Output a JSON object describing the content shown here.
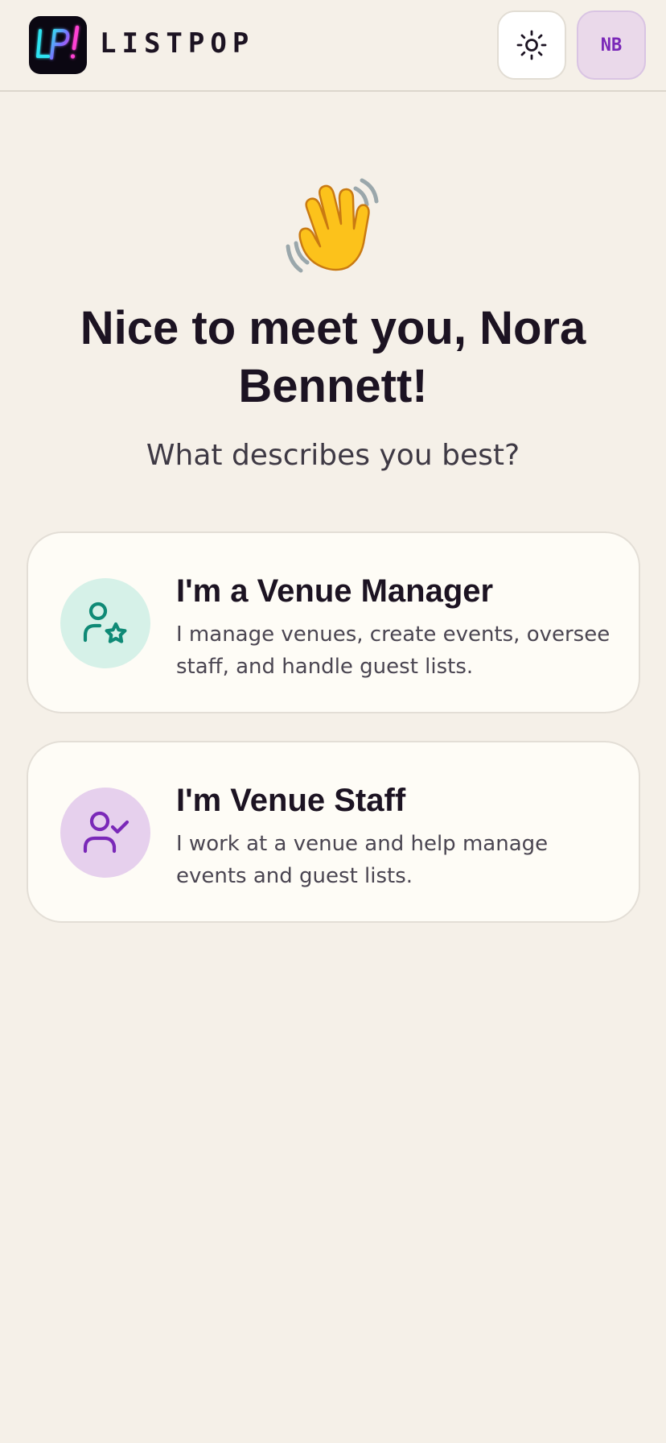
{
  "header": {
    "brand": "LISTPOP",
    "logo_text": "LP!",
    "theme_icon": "sun-icon",
    "avatar_initials": "NB"
  },
  "hero": {
    "emoji": "waving-hand-emoji",
    "title": "Nice to meet you, Nora Bennett!",
    "subtitle": "What describes you best?"
  },
  "roles": [
    {
      "title": "I'm a Venue Manager",
      "description": "I manage venues, create events, oversee staff, and handle guest lists.",
      "icon": "user-star-icon",
      "accent": "#0f8a76",
      "icon_bg": "#d6f1e8"
    },
    {
      "title": "I'm Venue Staff",
      "description": "I work at a venue and help manage events and guest lists.",
      "icon": "user-check-icon",
      "accent": "#7a28b8",
      "icon_bg": "#e6d0ed"
    }
  ],
  "colors": {
    "background": "#f5f0e8",
    "card": "#fefcf6",
    "text": "#1c1322",
    "avatar_text": "#7a28b8",
    "avatar_bg": "#ead9ea"
  }
}
